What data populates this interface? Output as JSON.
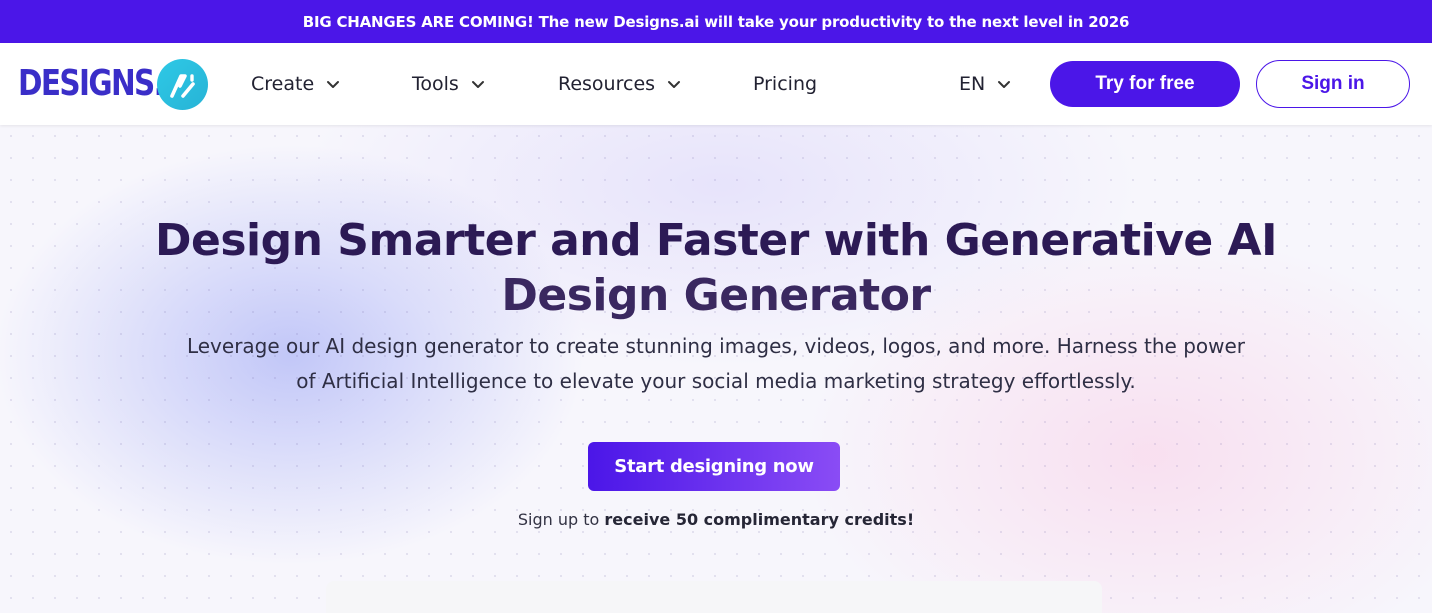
{
  "announcement": {
    "text": "BIG CHANGES ARE COMING! The new Designs.ai will take your productivity to the next level in 2026"
  },
  "header": {
    "logo_text": "DESIGNS.",
    "nav": [
      {
        "label": "Create",
        "has_dropdown": true
      },
      {
        "label": "Tools",
        "has_dropdown": true
      },
      {
        "label": "Resources",
        "has_dropdown": true
      },
      {
        "label": "Pricing",
        "has_dropdown": false
      }
    ],
    "language": "EN",
    "try_button": "Try for free",
    "signin_button": "Sign in"
  },
  "hero": {
    "headline_line1": "Design Smarter and Faster with Generative AI",
    "headline_line2": "Design Generator",
    "subtext_line1": "Leverage our AI design generator to create stunning images, videos, logos, and more. Harness the power",
    "subtext_line2": "of Artificial Intelligence to elevate your social media marketing strategy effortlessly.",
    "cta_button": "Start designing now",
    "note_prefix": "Sign up to ",
    "note_bold": "receive 50 complimentary credits!"
  },
  "colors": {
    "brand": "#4b16e8",
    "logo_badge": "#2ec9e6",
    "headline": "#2c1a55"
  },
  "icons": {
    "dropdown": "chevron-down-icon",
    "logo_badge": "ai-logo-icon"
  }
}
